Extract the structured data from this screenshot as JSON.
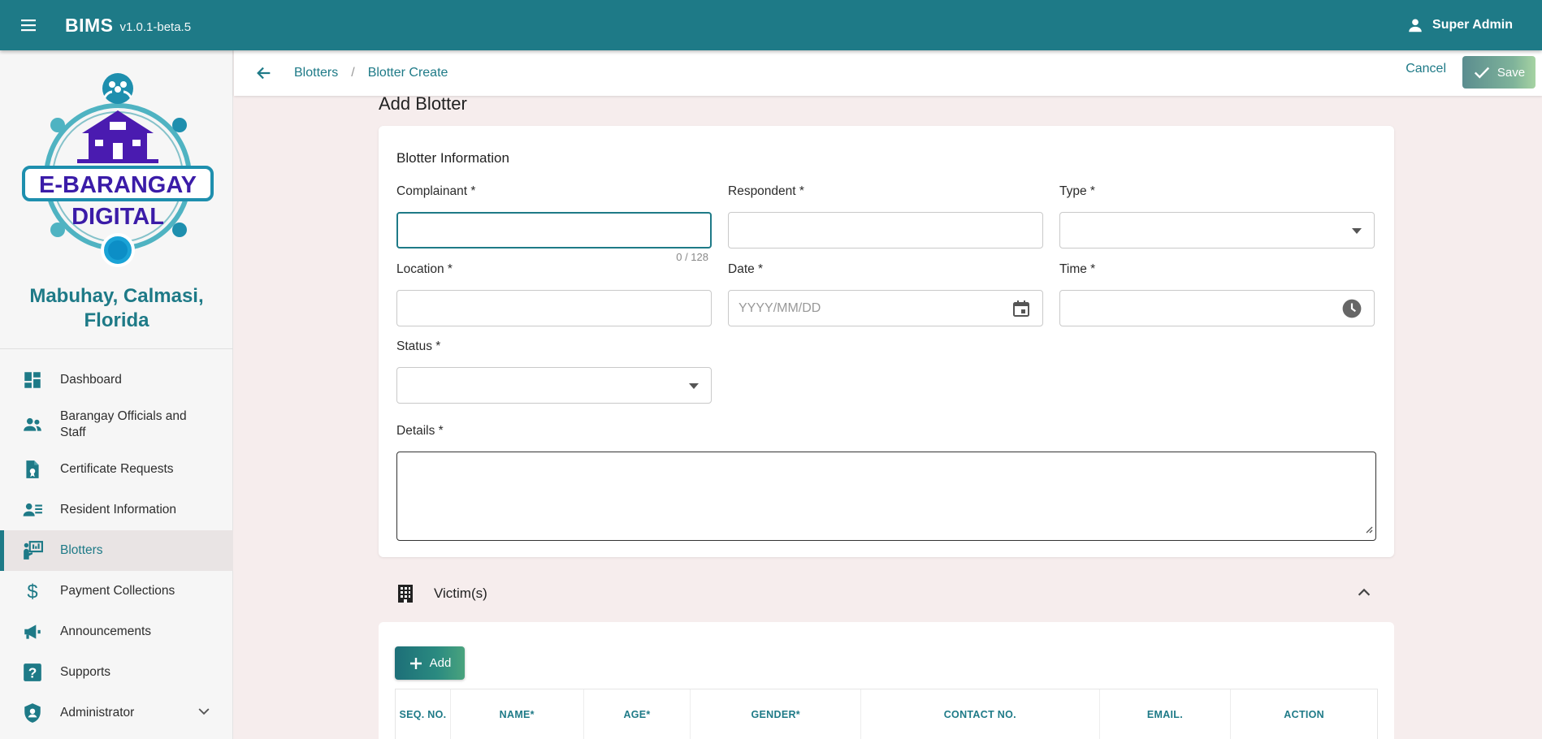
{
  "header": {
    "title": "BIMS",
    "version": "v1.0.1-beta.5",
    "user": "Super Admin"
  },
  "sidebar": {
    "logo": {
      "line1": "E-BARANGAY",
      "line2": "DIGITAL"
    },
    "barangay_name": "Mabuhay, Calmasi, Florida",
    "items": [
      {
        "label": "Dashboard",
        "icon": "dashboard-icon"
      },
      {
        "label": "Barangay Officials and Staff",
        "icon": "people-icon"
      },
      {
        "label": "Certificate Requests",
        "icon": "certificate-icon"
      },
      {
        "label": "Resident Information",
        "icon": "resident-card-icon"
      },
      {
        "label": "Blotters",
        "icon": "presenter-icon",
        "active": true
      },
      {
        "label": "Payment Collections",
        "icon": "dollar-icon"
      },
      {
        "label": "Announcements",
        "icon": "megaphone-icon"
      },
      {
        "label": "Supports",
        "icon": "help-icon"
      },
      {
        "label": "Administrator",
        "icon": "shield-icon",
        "expandable": true
      }
    ]
  },
  "breadcrumb": {
    "parent": "Blotters",
    "separator": "/",
    "current": "Blotter Create"
  },
  "actions": {
    "cancel": "Cancel",
    "save": "Save"
  },
  "page": {
    "title": "Add Blotter"
  },
  "form": {
    "section_title": "Blotter Information",
    "complainant": {
      "label": "Complainant *",
      "value": "",
      "counter": "0 / 128"
    },
    "respondent": {
      "label": "Respondent *",
      "value": ""
    },
    "type": {
      "label": "Type *",
      "value": ""
    },
    "location": {
      "label": "Location *",
      "value": ""
    },
    "date": {
      "label": "Date *",
      "placeholder": "YYYY/MM/DD",
      "value": ""
    },
    "time": {
      "label": "Time *",
      "value": ""
    },
    "status": {
      "label": "Status *",
      "value": ""
    },
    "details": {
      "label": "Details *",
      "value": ""
    }
  },
  "victims": {
    "title": "Victim(s)",
    "add_label": "Add",
    "columns": [
      "SEQ. NO.",
      "NAME*",
      "AGE*",
      "GENDER*",
      "CONTACT NO.",
      "EMAIL.",
      "ACTION"
    ]
  },
  "colors": {
    "primary": "#1e7a87",
    "background": "#f6eded"
  }
}
